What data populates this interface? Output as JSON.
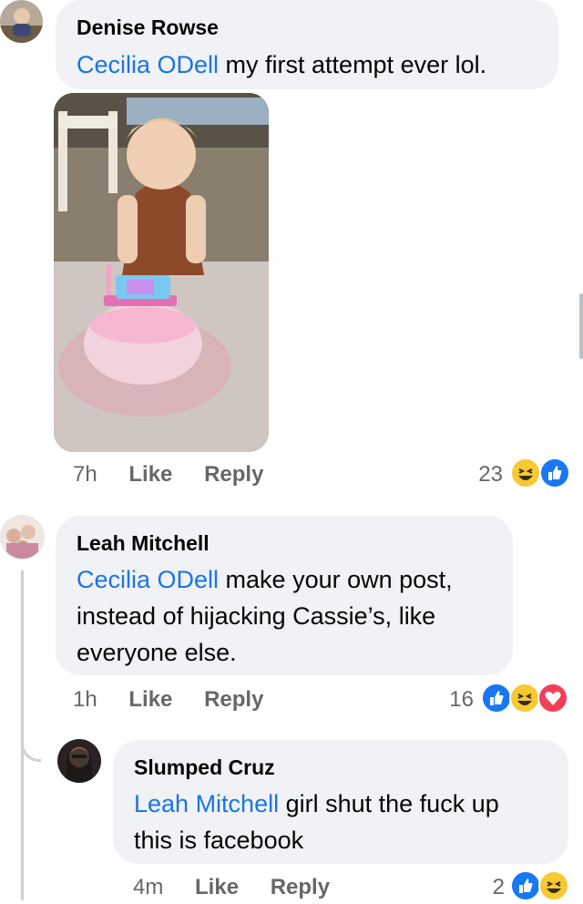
{
  "comments": [
    {
      "author": "Denise Rowse",
      "mention": "Cecilia ODell",
      "text": " my first attempt ever lol.",
      "time": "7h",
      "like": "Like",
      "reply": "Reply",
      "reaction_count": "23",
      "reactions": [
        "haha-icon",
        "like-icon"
      ]
    },
    {
      "author": "Leah Mitchell",
      "mention": "Cecilia ODell",
      "text_line1": " make your own post,",
      "text_line2": "instead of hijacking Cassie’s, like",
      "text_line3": "everyone else.",
      "time": "1h",
      "like": "Like",
      "reply": "Reply",
      "reaction_count": "16",
      "reactions": [
        "like-icon",
        "haha-icon",
        "love-icon"
      ]
    },
    {
      "author": "Slumped Cruz",
      "mention": "Leah Mitchell",
      "text_line1": " girl shut the fuck up",
      "text_line2": "this is facebook",
      "time": "4m",
      "like": "Like",
      "reply": "Reply",
      "reaction_count": "2",
      "reactions": [
        "like-icon",
        "haha-icon"
      ]
    }
  ],
  "colors": {
    "mention": "#1b74e4",
    "bubble": "#f0f2f5",
    "meta": "#65676b",
    "like_blue": "#1877f2",
    "haha_yellow": "#f7c932",
    "love_red": "#f33e58"
  }
}
